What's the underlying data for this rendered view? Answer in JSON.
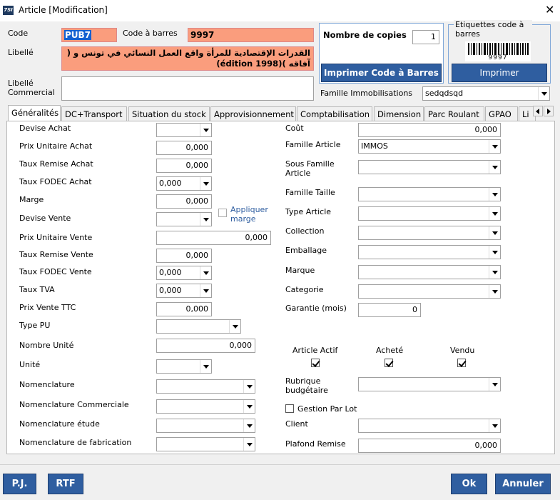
{
  "window": {
    "icon_text": "7SI",
    "title": "Article [Modification]"
  },
  "header": {
    "code_label": "Code",
    "code_value": "PUB7",
    "barcode_label": "Code à barres",
    "barcode_value": "9997",
    "libelle_label": "Libellé",
    "libelle_line1": "القدرات الإقتصادية للمرأة واقع العمل النسائي في تونس و (",
    "libelle_line2": "آفاقه )(édition 1998)",
    "libelle_commercial_label_1": "Libellé",
    "libelle_commercial_label_2": "Commercial",
    "libelle_commercial_value": ""
  },
  "copies": {
    "label": "Nombre de copies",
    "value": "1",
    "print_button": "Imprimer Code à Barres"
  },
  "etiquettes": {
    "title": "Etiquettes code à barres",
    "barcode_digits": "9997",
    "print_button": "Imprimer"
  },
  "famille_immo": {
    "label": "Famille Immobilisations",
    "value": "sedqdsqd"
  },
  "tabs": [
    "Généralités",
    "DC+Transport",
    "Situation du stock",
    "Approvisionnement",
    "Comptabilisation",
    "Dimension",
    "Parc Roulant",
    "GPAO",
    "Li"
  ],
  "left": {
    "devise_achat": {
      "label": "Devise Achat",
      "value": ""
    },
    "pu_achat": {
      "label": "Prix Unitaire Achat",
      "value": "0,000"
    },
    "remise_achat": {
      "label": "Taux Remise Achat",
      "value": "0,000"
    },
    "fodec_achat": {
      "label": "Taux FODEC Achat",
      "value": "0,000"
    },
    "marge": {
      "label": "Marge",
      "value": "0,000"
    },
    "appliquer_marge_1": "Appliquer",
    "appliquer_marge_2": "marge",
    "devise_vente": {
      "label": "Devise Vente",
      "value": ""
    },
    "pu_vente": {
      "label": "Prix Unitaire Vente",
      "value": "0,000"
    },
    "remise_vente": {
      "label": "Taux Remise Vente",
      "value": "0,000"
    },
    "fodec_vente": {
      "label": "Taux FODEC Vente",
      "value": "0,000"
    },
    "tva": {
      "label": "Taux TVA",
      "value": "0,000"
    },
    "pv_ttc": {
      "label": "Prix Vente TTC",
      "value": "0,000"
    },
    "type_pu": {
      "label": "Type PU",
      "value": ""
    },
    "nombre_unite": {
      "label": "Nombre Unité",
      "value": "0,000"
    },
    "unite": {
      "label": "Unité",
      "value": ""
    },
    "nomenclature": {
      "label": "Nomenclature",
      "value": ""
    },
    "nomenclature_com": {
      "label": "Nomenclature Commerciale",
      "value": ""
    },
    "nomenclature_etude": {
      "label": "Nomenclature étude",
      "value": ""
    },
    "nomenclature_fab": {
      "label": "Nomenclature de fabrication",
      "value": ""
    }
  },
  "right": {
    "cout": {
      "label": "Coût",
      "value": "0,000"
    },
    "famille_article": {
      "label": "Famille Article",
      "value": "IMMOS"
    },
    "sous_famille_1": "Sous Famille",
    "sous_famille_2": "Article",
    "famille_taille": {
      "label": "Famille Taille",
      "value": ""
    },
    "type_article": {
      "label": "Type Article",
      "value": ""
    },
    "collection": {
      "label": "Collection",
      "value": ""
    },
    "emballage": {
      "label": "Emballage",
      "value": ""
    },
    "marque": {
      "label": "Marque",
      "value": ""
    },
    "categorie": {
      "label": "Categorie",
      "value": ""
    },
    "garantie": {
      "label": "Garantie (mois)",
      "value": "0"
    },
    "article_actif": "Article Actif",
    "achete": "Acheté",
    "vendu": "Vendu",
    "rubrique_1": "Rubrique",
    "rubrique_2": "budgétaire",
    "gestion_lot": "Gestion Par Lot",
    "client": {
      "label": "Client",
      "value": ""
    },
    "plafond": {
      "label": "Plafond Remise",
      "value": "0,000"
    }
  },
  "footer": {
    "pj": "P.J.",
    "rtf": "RTF",
    "ok": "Ok",
    "annuler": "Annuler"
  }
}
